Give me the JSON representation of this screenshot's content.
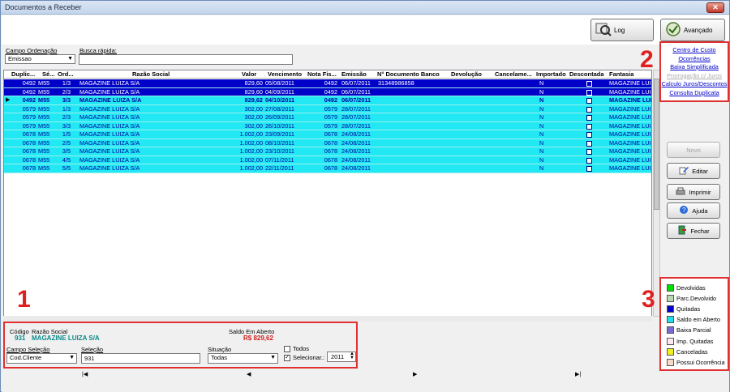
{
  "window": {
    "title": "Documentos a Receber",
    "close_glyph": "✕"
  },
  "toolbar": {
    "log_label": "Log",
    "advanced_label": "Avançado"
  },
  "filters": {
    "campo_ordenacao_label": "Campo Ordenação",
    "campo_ordenacao_value": "Emissao",
    "busca_rapida_label": "Busca rápida:",
    "busca_rapida_value": ""
  },
  "grid": {
    "columns": [
      "Duplic...",
      "Sé...",
      "Ord...",
      "Razão Social",
      "Valor",
      "Vencimento",
      "Nota Fis...",
      "Emissão",
      "N° Documento Banco",
      "Devolução",
      "Cancelame...",
      "Importado",
      "Descontada",
      "Fantasia"
    ],
    "rows": [
      {
        "dup": "0492",
        "ser": "M55",
        "ord": "1/3",
        "razao": "MAGAZINE LUIZA S/A",
        "valor": "829,60",
        "venc": "05/08/2011",
        "nota": "0492",
        "emissao": "06/07/2011",
        "doc": "31348986858",
        "dev": "",
        "canc": "",
        "imp": "N",
        "fantasia": "MAGAZINE LUI"
      },
      {
        "dup": "0492",
        "ser": "M55",
        "ord": "2/3",
        "razao": "MAGAZINE LUIZA S/A",
        "valor": "829,60",
        "venc": "04/09/2011",
        "nota": "0492",
        "emissao": "06/07/2011",
        "doc": "",
        "dev": "",
        "canc": "",
        "imp": "N",
        "fantasia": "MAGAZINE LUI"
      },
      {
        "dup": "0492",
        "ser": "M55",
        "ord": "3/3",
        "razao": "MAGAZINE LUIZA S/A",
        "valor": "829,62",
        "venc": "04/10/2011",
        "nota": "0492",
        "emissao": "06/07/2011",
        "doc": "",
        "dev": "",
        "canc": "",
        "imp": "N",
        "fantasia": "MAGAZINE LUI"
      },
      {
        "dup": "0579",
        "ser": "M55",
        "ord": "1/3",
        "razao": "MAGAZINE LUIZA S/A",
        "valor": "302,00",
        "venc": "27/08/2011",
        "nota": "0579",
        "emissao": "28/07/2011",
        "doc": "",
        "dev": "",
        "canc": "",
        "imp": "N",
        "fantasia": "MAGAZINE LUI"
      },
      {
        "dup": "0579",
        "ser": "M55",
        "ord": "2/3",
        "razao": "MAGAZINE LUIZA S/A",
        "valor": "302,00",
        "venc": "26/09/2011",
        "nota": "0579",
        "emissao": "28/07/2011",
        "doc": "",
        "dev": "",
        "canc": "",
        "imp": "N",
        "fantasia": "MAGAZINE LUI"
      },
      {
        "dup": "0579",
        "ser": "M55",
        "ord": "3/3",
        "razao": "MAGAZINE LUIZA S/A",
        "valor": "302,00",
        "venc": "26/10/2011",
        "nota": "0579",
        "emissao": "28/07/2011",
        "doc": "",
        "dev": "",
        "canc": "",
        "imp": "N",
        "fantasia": "MAGAZINE LUI"
      },
      {
        "dup": "0678",
        "ser": "M55",
        "ord": "1/5",
        "razao": "MAGAZINE LUIZA S/A",
        "valor": "1.002,00",
        "venc": "23/09/2011",
        "nota": "0678",
        "emissao": "24/08/2011",
        "doc": "",
        "dev": "",
        "canc": "",
        "imp": "N",
        "fantasia": "MAGAZINE LUI"
      },
      {
        "dup": "0678",
        "ser": "M55",
        "ord": "2/5",
        "razao": "MAGAZINE LUIZA S/A",
        "valor": "1.002,00",
        "venc": "08/10/2011",
        "nota": "0678",
        "emissao": "24/08/2011",
        "doc": "",
        "dev": "",
        "canc": "",
        "imp": "N",
        "fantasia": "MAGAZINE LUI"
      },
      {
        "dup": "0678",
        "ser": "M55",
        "ord": "3/5",
        "razao": "MAGAZINE LUIZA S/A",
        "valor": "1.002,00",
        "venc": "23/10/2011",
        "nota": "0678",
        "emissao": "24/08/2011",
        "doc": "",
        "dev": "",
        "canc": "",
        "imp": "N",
        "fantasia": "MAGAZINE LUI"
      },
      {
        "dup": "0678",
        "ser": "M55",
        "ord": "4/5",
        "razao": "MAGAZINE LUIZA S/A",
        "valor": "1.002,00",
        "venc": "07/11/2011",
        "nota": "0678",
        "emissao": "24/08/2011",
        "doc": "",
        "dev": "",
        "canc": "",
        "imp": "N",
        "fantasia": "MAGAZINE LUI"
      },
      {
        "dup": "0678",
        "ser": "M55",
        "ord": "5/5",
        "razao": "MAGAZINE LUIZA S/A",
        "valor": "1.002,00",
        "venc": "22/11/2011",
        "nota": "0678",
        "emissao": "24/08/2011",
        "doc": "",
        "dev": "",
        "canc": "",
        "imp": "N",
        "fantasia": "MAGAZINE LUI"
      }
    ]
  },
  "details": {
    "codigo_label": "Código",
    "razao_label": "Razão Social",
    "codigo_value": "931",
    "razao_value": "MAGAZINE LUIZA S/A",
    "saldo_label": "Saldo Em Aberto",
    "saldo_value": "R$ 829,62",
    "campo_selecao_label": "Campo Seleção",
    "campo_selecao_value": "Cod.Cliente",
    "selecao_label": "Seleção",
    "selecao_value": "931",
    "situacao_label": "Situação",
    "situacao_value": "Todas",
    "todos_label": "Todos",
    "selecionar_label": "Selecionar.:",
    "year_value": "2011"
  },
  "links": [
    "Centro de Custo",
    "Ocorrências",
    "Baixa Simplificada",
    "Prorrogação c/ Juros",
    "Calculo Juros/Descontos",
    "Consulta Duplicata"
  ],
  "side_buttons": {
    "novo": "Novo",
    "editar": "Editar",
    "imprimir": "Imprimir",
    "ajuda": "Ajuda",
    "fechar": "Fechar"
  },
  "legend": [
    {
      "label": "Devolvidas",
      "color": "#00dd00"
    },
    {
      "label": "Parc.Devolvido",
      "color": "#b8d8b0"
    },
    {
      "label": "Quitadas",
      "color": "#0000c8"
    },
    {
      "label": "Saldo em Aberto",
      "color": "#22ddee"
    },
    {
      "label": "Baixa Parcial",
      "color": "#7a6ad8"
    },
    {
      "label": "Imp. Quitadas",
      "color": "#ffe8f0"
    },
    {
      "label": "Canceladas",
      "color": "#f0f020"
    },
    {
      "label": "Possui Ocorrência",
      "color": "#f8dcc8"
    }
  ],
  "callouts": {
    "n1": "1",
    "n2": "2",
    "n3": "3"
  },
  "nav": {
    "first": "|◀",
    "prev": "◀",
    "next": "▶",
    "last": "▶|"
  }
}
